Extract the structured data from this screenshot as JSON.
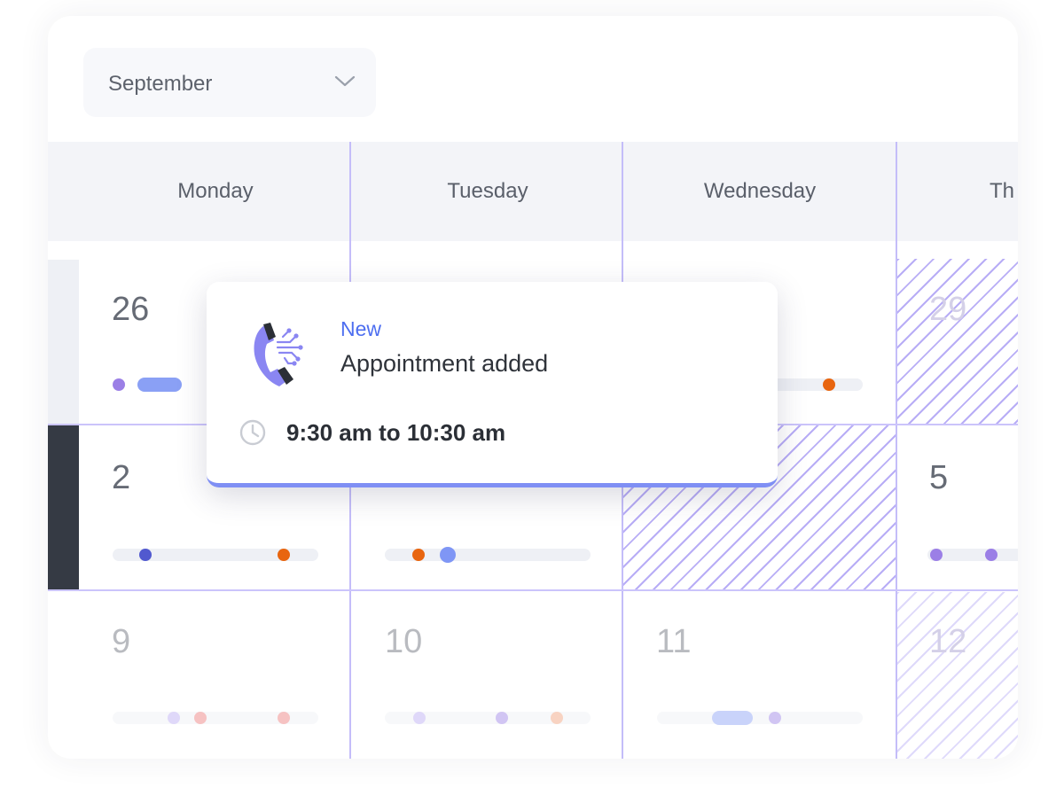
{
  "month_select": {
    "value": "September",
    "icon": "chevron-down-icon"
  },
  "weekdays": [
    "Monday",
    "Tuesday",
    "Wednesday",
    "Th"
  ],
  "weeks": [
    {
      "dates": [
        "26",
        "",
        "",
        "29"
      ]
    },
    {
      "dates": [
        "2",
        "",
        "",
        "5"
      ]
    },
    {
      "dates": [
        "9",
        "10",
        "11",
        "12"
      ]
    }
  ],
  "popup": {
    "badge": "New",
    "title": "Appointment added",
    "time": "9:30 am to 10:30 am",
    "icon": "phone-icon",
    "time_icon": "clock-icon",
    "accent_color": "#7f8ff4"
  },
  "colors": {
    "grid_line": "#c4bdf9",
    "hatch": "#b8adf6",
    "dot_purple": "#9b7fe6",
    "dot_indigo": "#5159cf",
    "dot_orange": "#e8650f",
    "dot_blue": "#7f96f5",
    "dot_red": "#ec7a7a"
  }
}
